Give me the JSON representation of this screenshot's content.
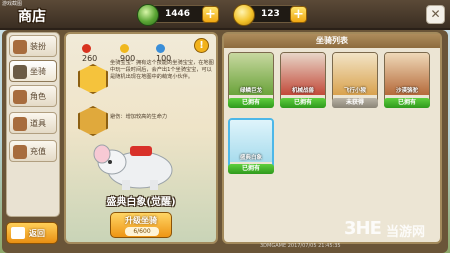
{
  "window": {
    "watermark_top": "游戏截图"
  },
  "header": {
    "title": "商店",
    "gems": "1446",
    "coins": "123",
    "plus_label": "+",
    "close_label": "✕"
  },
  "sidebar": {
    "items": [
      {
        "label": "装扮",
        "icon": "outfit-icon"
      },
      {
        "label": "坐骑",
        "icon": "mount-icon"
      },
      {
        "label": "角色",
        "icon": "character-icon"
      },
      {
        "label": "道具",
        "icon": "item-icon"
      },
      {
        "label": "充值",
        "icon": "recharge-icon"
      }
    ],
    "active_index": 1,
    "back_label": "返回"
  },
  "detail": {
    "stats": {
      "hp": "260",
      "attack": "900",
      "speed": "100"
    },
    "skill1_text": "坐骑宝宝：拥有这个技能的坐骑宝宝，在地图中玩一段时间后，会产出1个坐骑宝宝，可以是随机出现在地图中的萌宠小伙伴。",
    "skill2_text": "避伤：增加较高的生命力",
    "mount_name": "盛典白象(觉醒)",
    "upgrade_label": "升级坐骑",
    "upgrade_cost": "6/600",
    "warn_label": "!"
  },
  "list": {
    "header": "坐骑列表",
    "mounts": [
      {
        "name": "绿鳞巨龙",
        "status": "已拥有",
        "owned": true,
        "color": "#6aa33a"
      },
      {
        "name": "机械战兽",
        "status": "已拥有",
        "owned": true,
        "color": "#c24a3a"
      },
      {
        "name": "飞行小猴",
        "status": "未获得",
        "owned": false,
        "color": "#d9a24e"
      },
      {
        "name": "沙漠骆驼",
        "status": "已拥有",
        "owned": true,
        "color": "#b56a3a"
      },
      {
        "name": "盛典白象",
        "status": "已拥有",
        "owned": true,
        "color": "#e8a2b8"
      }
    ]
  },
  "footer": {
    "watermark_bottom": "3DMGAME 2017/07/05 21:45:35",
    "logo_latin": "3HE",
    "logo_cn": "当游网"
  }
}
